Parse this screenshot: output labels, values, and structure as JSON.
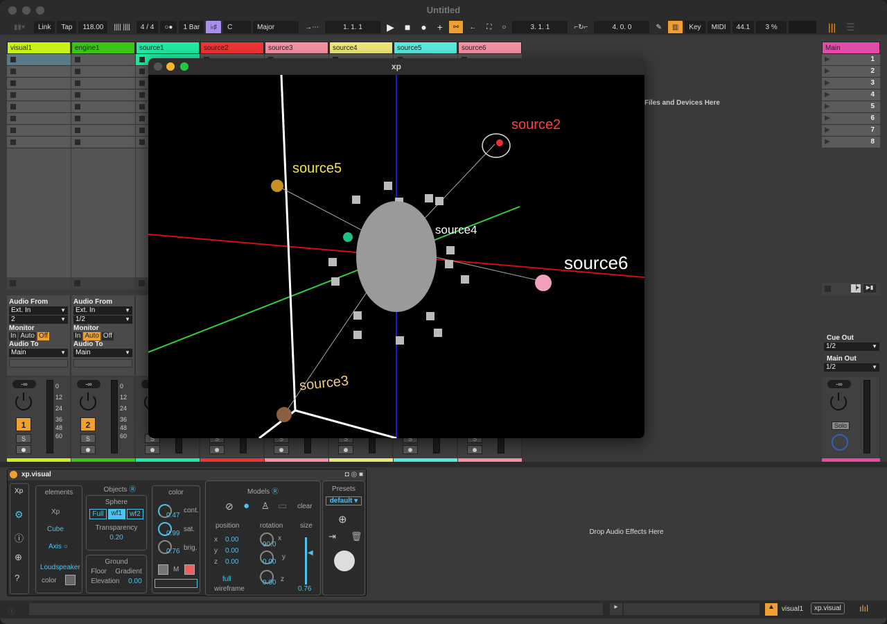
{
  "app": {
    "title": "Untitled"
  },
  "toolbar": {
    "link": "Link",
    "tap": "Tap",
    "tempo": "118.00",
    "time_sig": "4 / 4",
    "metronome": "○●",
    "quantize": "1 Bar",
    "scale_root": "C",
    "scale_mode": "Major",
    "position": "1.  1.  1",
    "loop_start": "3.  1.  1",
    "loop_length": "4.  0.  0",
    "key": "Key",
    "midi": "MIDI",
    "sample_rate": "44.1",
    "cpu": "3 %"
  },
  "tracks": [
    {
      "name": "visual1",
      "color": "#c6f21a",
      "audio_from": "Ext. In",
      "channel": "2",
      "monitor": "Off",
      "audio_to": "Main",
      "number": "1"
    },
    {
      "name": "engine1",
      "color": "#3cc31a",
      "audio_from": "Ext. In",
      "channel": "1/2",
      "monitor": "Auto",
      "audio_to": "Main",
      "number": "2"
    },
    {
      "name": "source1",
      "color": "#22eaa0"
    },
    {
      "name": "source2",
      "color": "#ee3535"
    },
    {
      "name": "source3",
      "color": "#f591a3"
    },
    {
      "name": "source4",
      "color": "#ede67a"
    },
    {
      "name": "source5",
      "color": "#5ce9dc"
    },
    {
      "name": "source6",
      "color": "#f591a3"
    }
  ],
  "labels": {
    "audio_from": "Audio From",
    "monitor": "Monitor",
    "audio_to": "Audio To",
    "in": "In",
    "auto": "Auto",
    "off": "Off",
    "solo": "S",
    "vol": "-∞",
    "meter_ticks": [
      "0",
      "12",
      "24",
      "36",
      "48",
      "60"
    ],
    "drop_files": "Files and Devices Here",
    "drop_effects": "Drop Audio Effects Here"
  },
  "main_track": {
    "name": "Main",
    "color": "#e44aa8",
    "scenes": [
      "1",
      "2",
      "3",
      "4",
      "5",
      "6",
      "7",
      "8"
    ],
    "cue_out_label": "Cue Out",
    "cue_out": "1/2",
    "main_out_label": "Main Out",
    "main_out": "1/2",
    "solo": "Solo",
    "vol": "-∞"
  },
  "xp_window": {
    "title": "xp",
    "sources": [
      {
        "name": "source2",
        "color": "#ff4040"
      },
      {
        "name": "source5",
        "color": "#f5e050"
      },
      {
        "name": "source4",
        "color": "#ffffff"
      },
      {
        "name": "source6",
        "color": "#ffffff"
      },
      {
        "name": "source3",
        "color": "#f5c880"
      }
    ]
  },
  "device": {
    "name": "xp.visual",
    "tabs": {
      "xp": "Xp"
    },
    "elements": {
      "title": "elements",
      "items": [
        "Xp",
        "Cube",
        "Axis",
        "Loudspeaker"
      ],
      "color": "color"
    },
    "objects": {
      "title": "Objects",
      "sphere": "Sphere",
      "modes": [
        "Full",
        "wf1",
        "wf2"
      ],
      "active_mode": "wf1",
      "transparency_label": "Transparency",
      "transparency": "0.20"
    },
    "ground": {
      "title": "Ground",
      "floor": "Floor",
      "gradient": "Gradient",
      "elevation_label": "Elevation",
      "elevation": "0.00"
    },
    "color": {
      "title": "color",
      "cont": "0.47",
      "cont_label": "cont.",
      "sat": "0.99",
      "sat_label": "sat.",
      "brig": "0.76",
      "brig_label": "brig.",
      "m": "M"
    },
    "models": {
      "title": "Models",
      "clear": "clear",
      "position_label": "position",
      "rotation_label": "rotation",
      "size_label": "size",
      "pos": {
        "x": "0.00",
        "y": "0.00",
        "z": "0.00"
      },
      "rot": {
        "x": "90.0",
        "y": "0.00",
        "z": "0.00"
      },
      "size": "0.76",
      "mode": "full",
      "mode_label": "wireframe"
    },
    "presets": {
      "title": "Presets",
      "selected": "default"
    }
  },
  "status": {
    "track": "visual1",
    "device": "xp.visual"
  }
}
